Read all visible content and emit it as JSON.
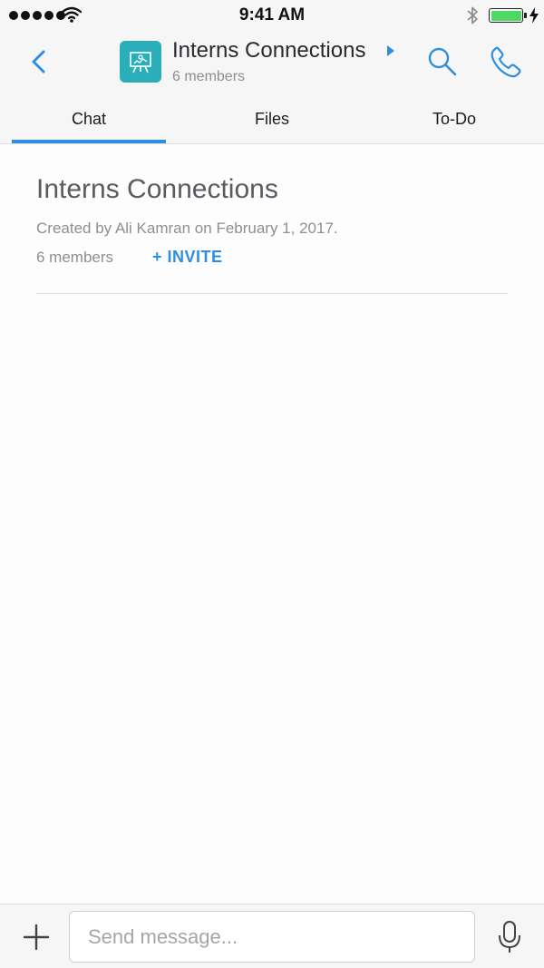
{
  "status_bar": {
    "time": "9:41 AM",
    "signal_icon": "signal-dots-icon",
    "wifi_icon": "wifi-icon",
    "bluetooth_icon": "bluetooth-icon",
    "battery_icon": "battery-icon",
    "battery_level": 1.0,
    "charging_icon": "charging-bolt-icon"
  },
  "header": {
    "back_icon": "chevron-left-icon",
    "avatar_icon": "presentation-board-icon",
    "title": "Interns Connections",
    "title_caret_icon": "caret-right-icon",
    "subtitle": "6 members",
    "search_icon": "search-icon",
    "call_icon": "phone-icon"
  },
  "tabs": [
    {
      "label": "Chat",
      "selected": true
    },
    {
      "label": "Files",
      "selected": false
    },
    {
      "label": "To-Do",
      "selected": false
    }
  ],
  "main": {
    "group_name": "Interns Connections",
    "created_info": "Created by Ali Kamran on February 1, 2017.",
    "member_count": "6 members",
    "invite_label": "+ INVITE"
  },
  "compose": {
    "add_icon": "plus-icon",
    "message_placeholder": "Send message...",
    "message_value": "",
    "mic_icon": "microphone-icon"
  },
  "colors": {
    "accent": "#2d8fdd",
    "avatar_bg": "#2aaeb9",
    "battery_fill": "#4cd964",
    "bar_bg": "#f6f6f7"
  }
}
